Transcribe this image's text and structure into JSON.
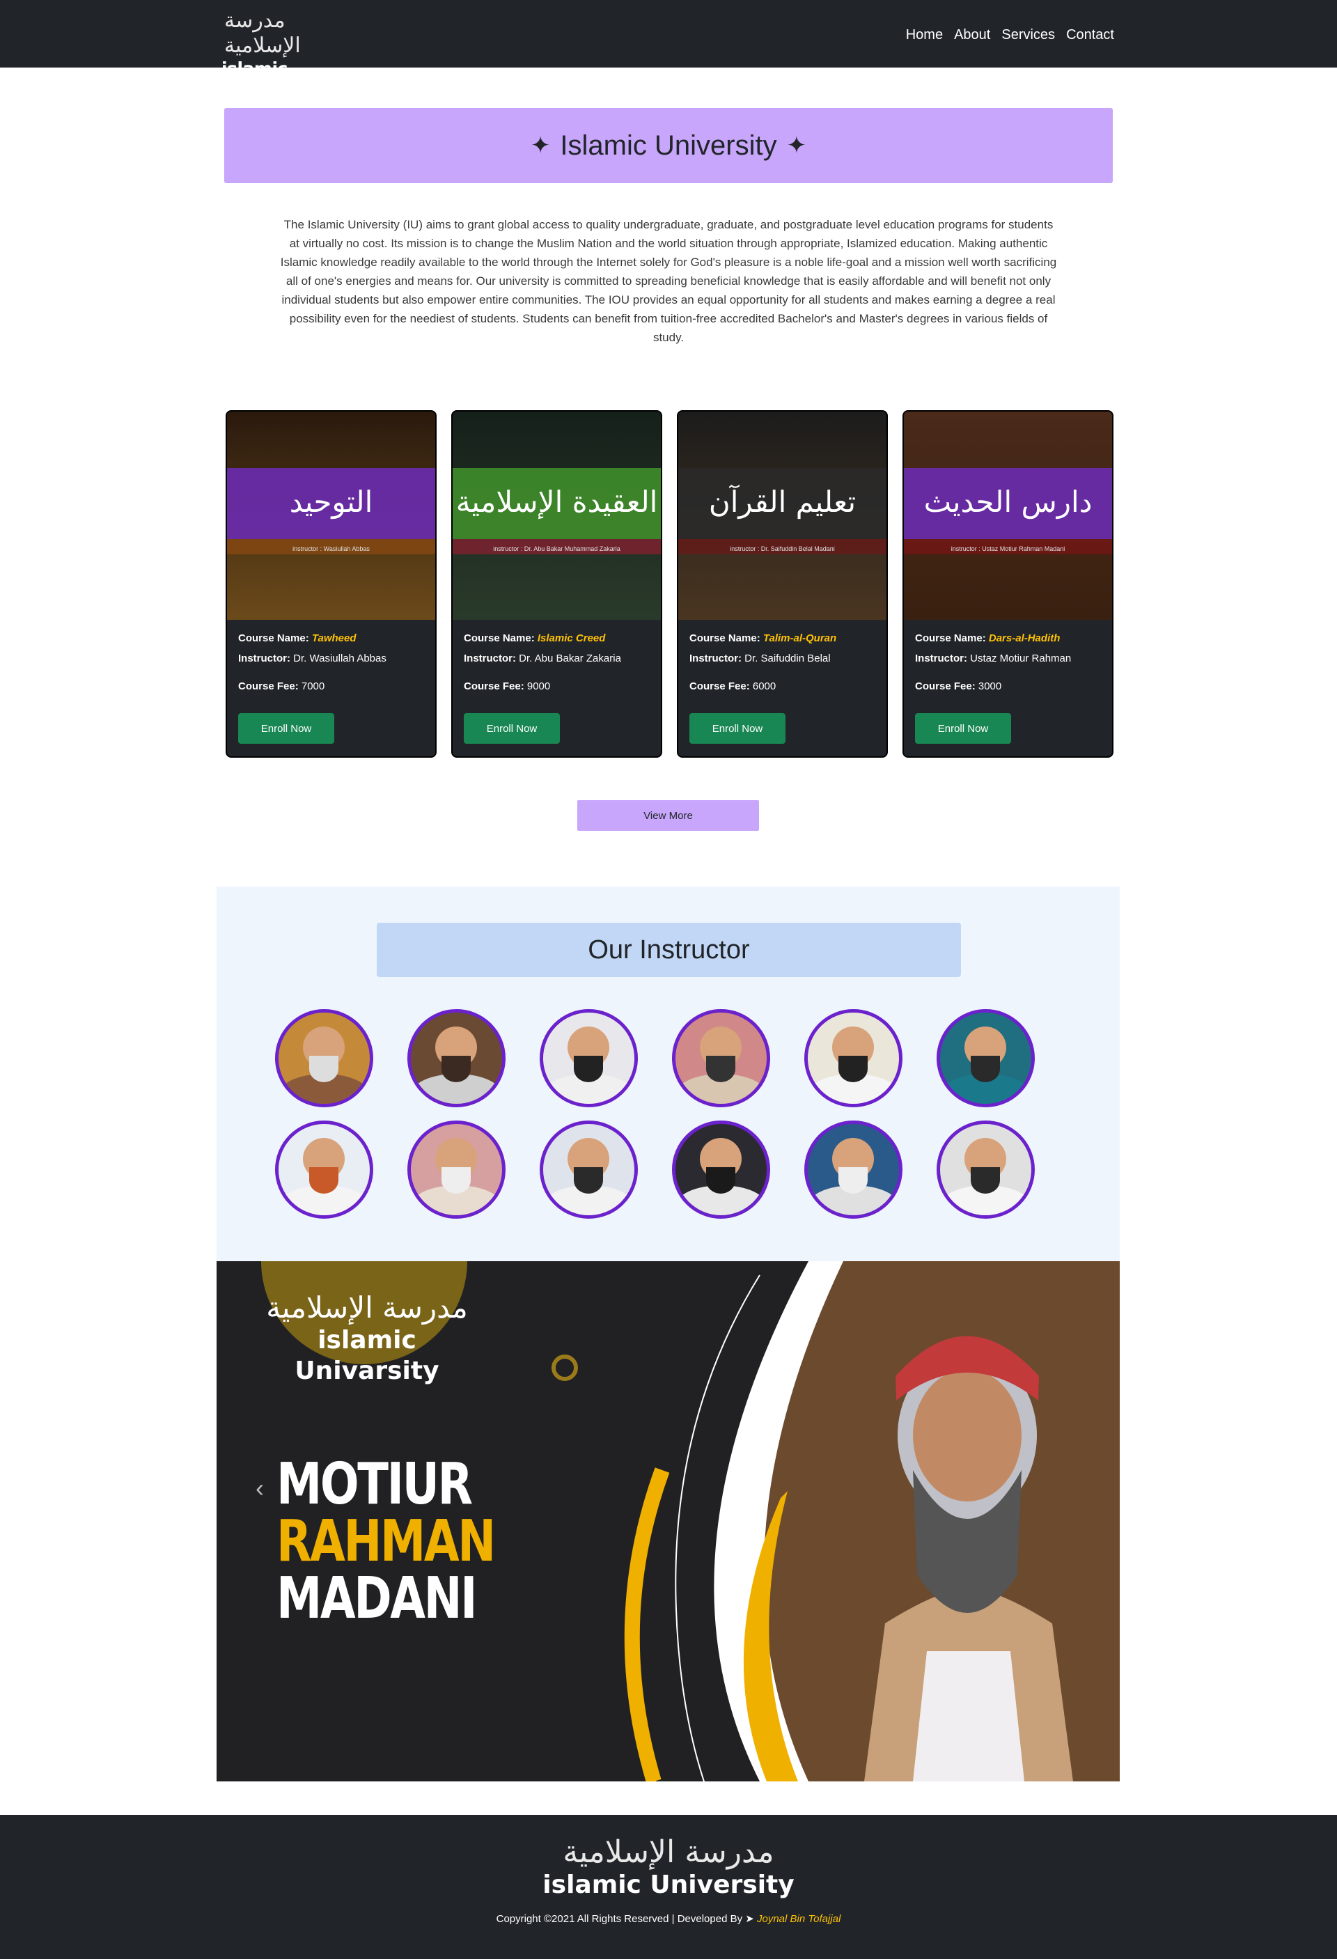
{
  "brand": {
    "arabic": "مدرسة الإسلامية",
    "english": "islamic University"
  },
  "nav": {
    "items": [
      {
        "label": "Home"
      },
      {
        "label": "About"
      },
      {
        "label": "Services"
      },
      {
        "label": "Contact"
      }
    ]
  },
  "hero": {
    "title": "Islamic University",
    "star": "✦",
    "description": "The Islamic University (IU) aims to grant global access to quality undergraduate, graduate, and postgraduate level education programs for students at virtually no cost. Its mission is to change the Muslim Nation and the world situation through appropriate, Islamized education. Making authentic Islamic knowledge readily available to the world through the Internet solely for God's pleasure is a noble life-goal and a mission well worth sacrificing all of one's energies and means for. Our university is committed to spreading beneficial knowledge that is easily affordable and will benefit not only individual students but also empower entire communities. The IOU provides an equal opportunity for all students and makes earning a degree a real possibility even for the neediest of students. Students can benefit from tuition-free accredited Bachelor's and Master's degrees in various fields of study."
  },
  "labels": {
    "course_name": "Course Name:",
    "instructor": "Instructor:",
    "course_fee": "Course Fee:",
    "enroll": "Enroll Now"
  },
  "courses": [
    {
      "name": "Tawheed",
      "instructor": "Dr. Wasiullah Abbas",
      "fee": "7000",
      "image_title": "التوحيد",
      "image_caption": "instructor : Wasiullah Abbas",
      "band_color": "#6a2bb0",
      "bg_top": "#2a1a0e",
      "bg_bottom": "#6b4a1a",
      "stripe": "#8b4a10"
    },
    {
      "name": "Islamic Creed",
      "instructor": "Dr. Abu Bakar Zakaria",
      "fee": "9000",
      "image_title": "العقيدة الإسلامية",
      "image_caption": "instructor : Dr. Abu Bakar Muhammad Zakaria",
      "band_color": "#3f8d2a",
      "bg_top": "#15201a",
      "bg_bottom": "#2a3a2a",
      "stripe": "#8a1f2f"
    },
    {
      "name": "Talim-al-Quran",
      "instructor": "Dr. Saifuddin Belal",
      "fee": "6000",
      "image_title": "تعليم القرآن",
      "image_caption": "instructor : Dr. Saifuddin Belal Madani",
      "band_color": "#2a2a2a",
      "bg_top": "#1c1c1c",
      "bg_bottom": "#4a3520",
      "stripe": "#6a1a1a"
    },
    {
      "name": "Dars-al-Hadith",
      "instructor": "Ustaz Motiur Rahman",
      "fee": "3000",
      "image_title": "دارس الحديث",
      "image_caption": "instructor : Ustaz Motiur Rahman Madani",
      "band_color": "#6a2bb0",
      "bg_top": "#4a2a1a",
      "bg_bottom": "#3a2010",
      "stripe": "#7a1515"
    }
  ],
  "view_more": "View More",
  "instructors": {
    "title": "Our Instructor",
    "avatars": [
      {
        "name": "instructor-1",
        "bg": "#c48a3a",
        "beard": "#dddddd",
        "body": "#8a5a3a"
      },
      {
        "name": "instructor-2",
        "bg": "#6a4a32",
        "beard": "#3a2a22",
        "body": "#cfcfcf"
      },
      {
        "name": "instructor-3",
        "bg": "#e8e8ec",
        "beard": "#222222",
        "body": "#f0f0f0"
      },
      {
        "name": "instructor-4",
        "bg": "#d08888",
        "beard": "#333333",
        "body": "#d9c6b0"
      },
      {
        "name": "instructor-5",
        "bg": "#eae6da",
        "beard": "#222222",
        "body": "#f5f5f5"
      },
      {
        "name": "instructor-6",
        "bg": "#1f6f80",
        "beard": "#2a2a2a",
        "body": "#1a7a8c"
      },
      {
        "name": "instructor-7",
        "bg": "#e9eef4",
        "beard": "#c85a2a",
        "body": "#f4f4f4"
      },
      {
        "name": "instructor-8",
        "bg": "#d6a0a0",
        "beard": "#eeeeee",
        "body": "#e8dcd0"
      },
      {
        "name": "instructor-9",
        "bg": "#dfe4ec",
        "beard": "#2a2a2a",
        "body": "#f2f2f2"
      },
      {
        "name": "instructor-10",
        "bg": "#2a2a30",
        "beard": "#1a1a1a",
        "body": "#e8e8e8"
      },
      {
        "name": "instructor-11",
        "bg": "#2a5a8a",
        "beard": "#eeeeee",
        "body": "#e0e0e0"
      },
      {
        "name": "instructor-12",
        "bg": "#e0e0e0",
        "beard": "#2a2a2a",
        "body": "#f5f5f5"
      }
    ]
  },
  "banner": {
    "logo_arabic": "مدرسة الإسلامية",
    "logo_english": "islamic Univarsity",
    "name_line1": "MOTIUR",
    "name_line2": "RAHMAN",
    "name_line3": "MADANI",
    "prev_icon": "chevron-left-icon",
    "prev_glyph": "‹"
  },
  "footer": {
    "logo_arabic": "مدرسة الإسلامية",
    "logo_english": "islamic University",
    "copyright": "Copyright ©2021 All Rights Reserved | Developed By ➤ ",
    "developer": "Joynal Bin Tofajjal"
  }
}
